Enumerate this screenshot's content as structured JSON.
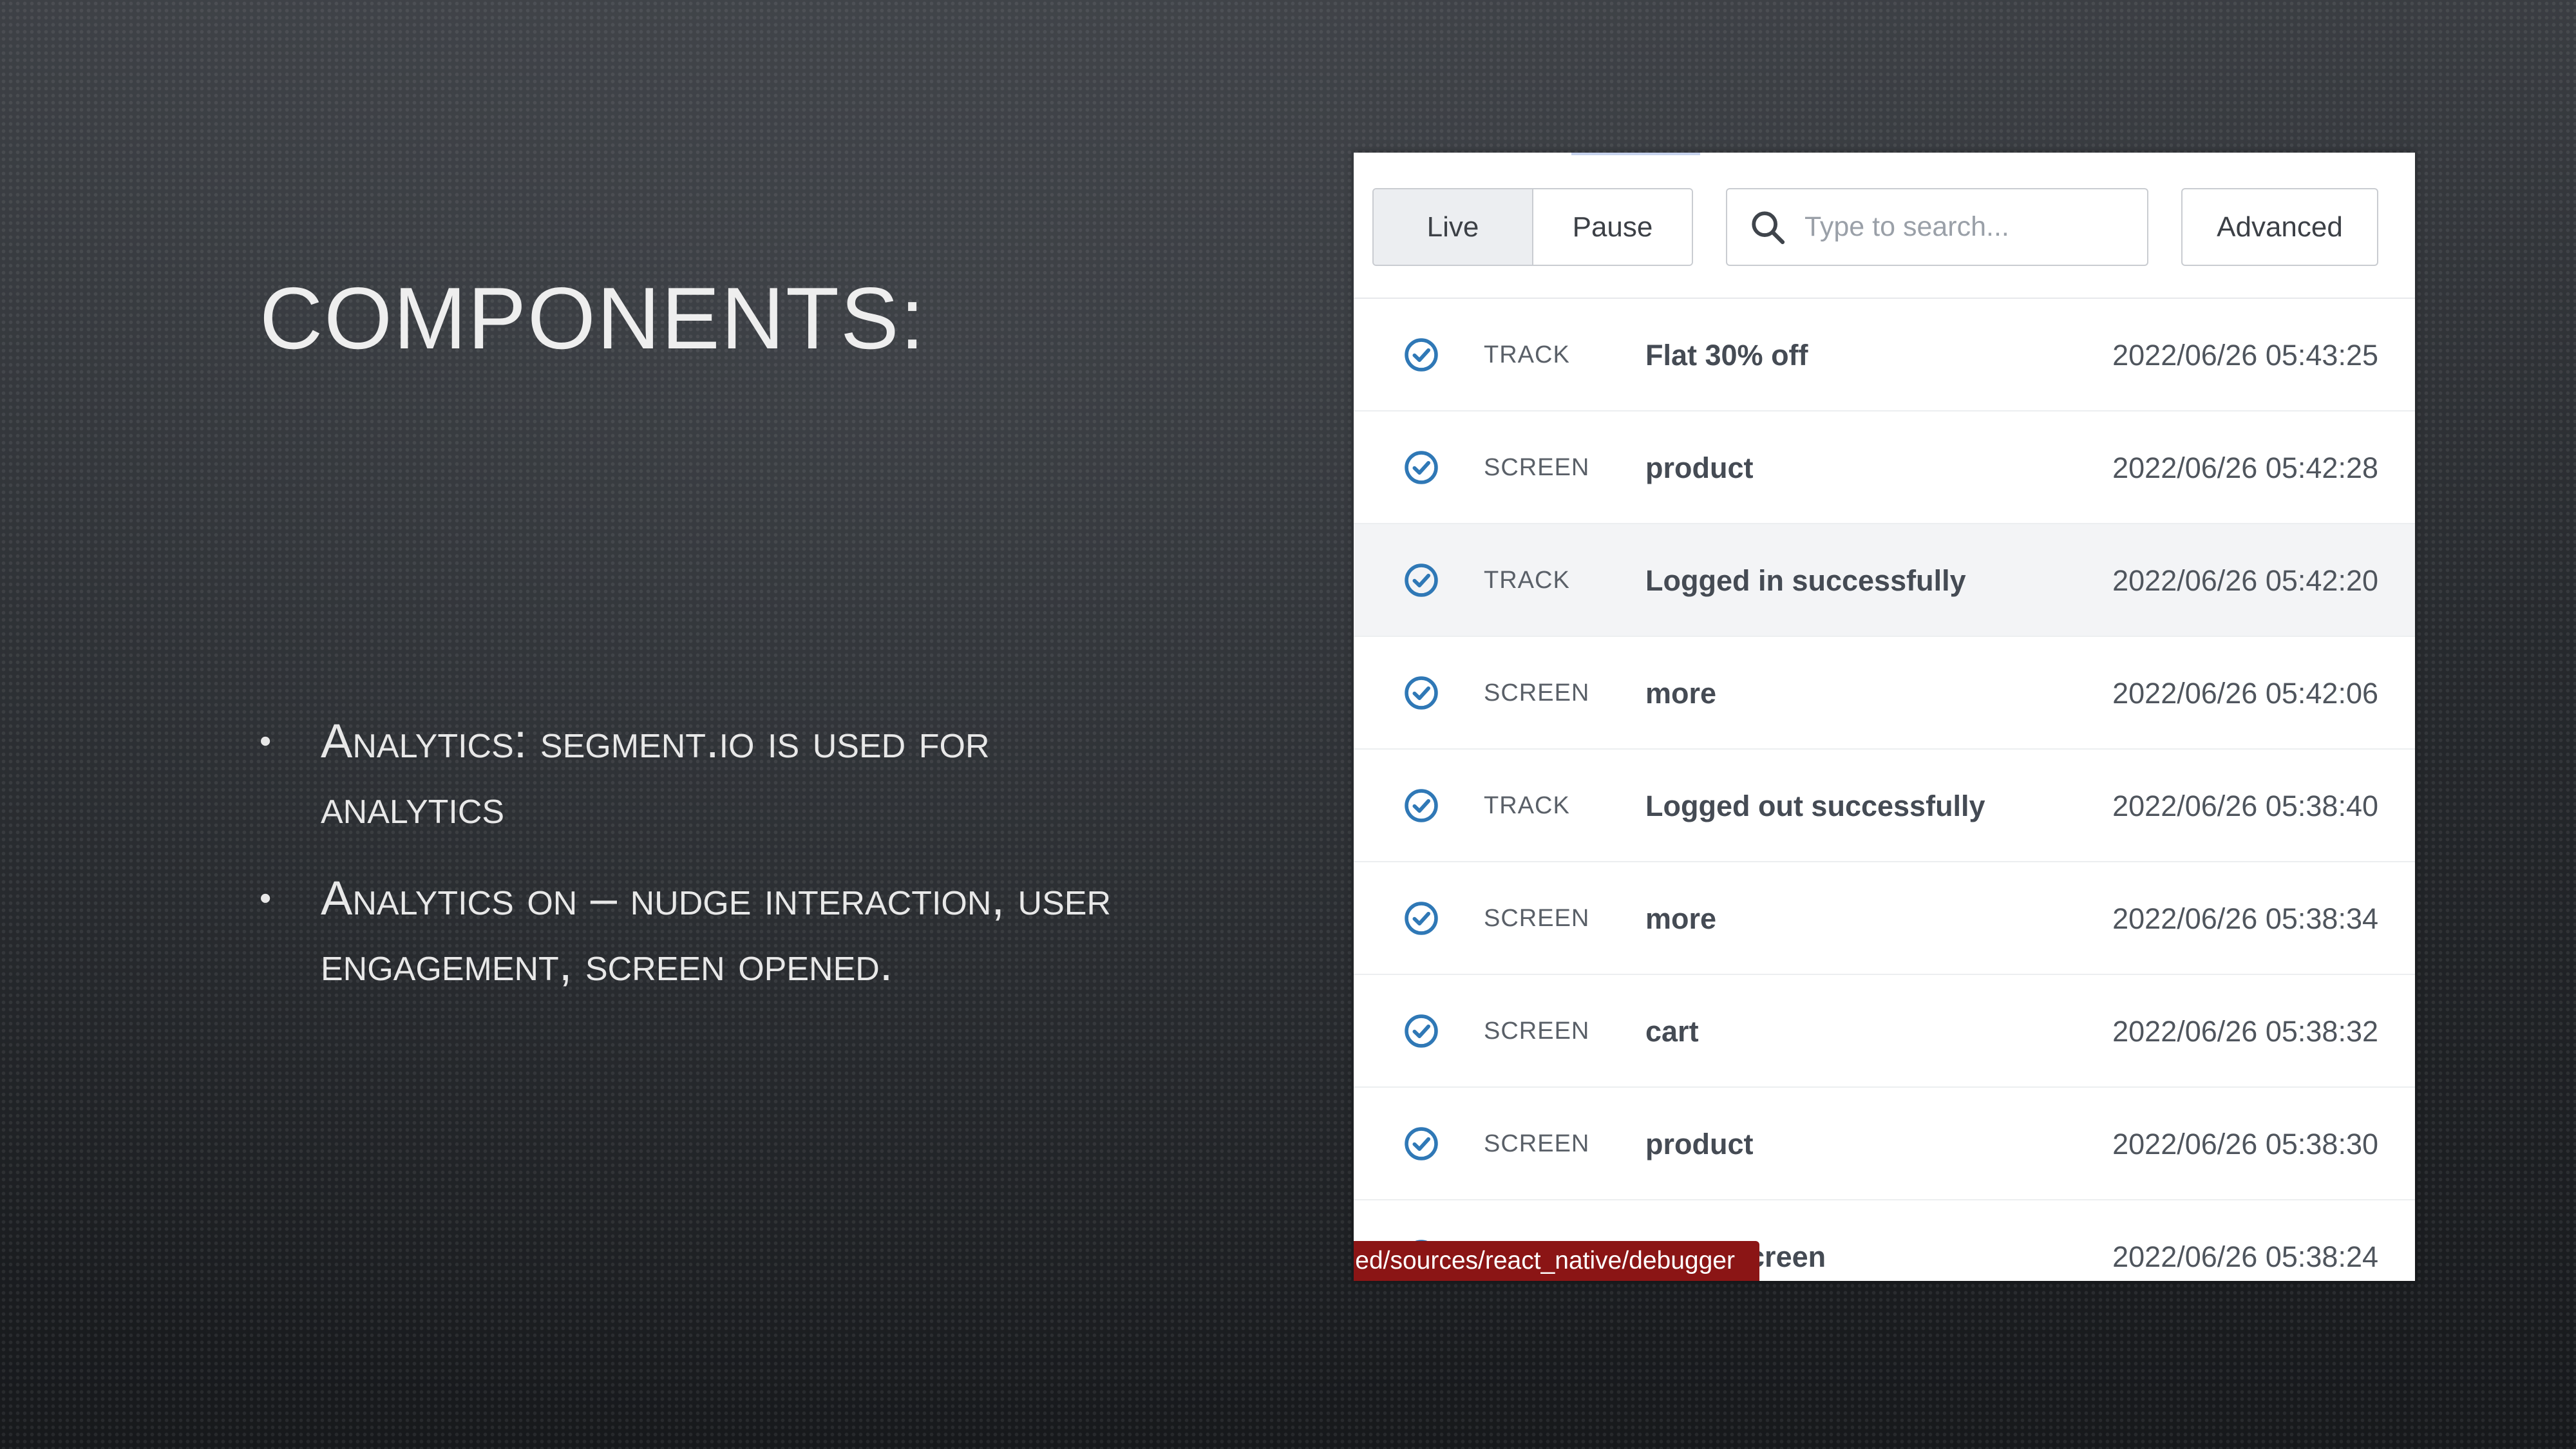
{
  "slide": {
    "title": "Components:",
    "bullets": [
      "Analytics: segment.io is used for analytics",
      "Analytics on – nudge interaction, user engagement, screen opened."
    ]
  },
  "debugger": {
    "mode_tabs": [
      {
        "label": "Live",
        "active": true
      },
      {
        "label": "Pause",
        "active": false
      }
    ],
    "search": {
      "placeholder": "Type to search...",
      "value": "",
      "icon": "search-icon"
    },
    "advanced_label": "Advanced",
    "status_icon": "check-circle-icon",
    "events": [
      {
        "type": "TRACK",
        "name": "Flat 30% off",
        "time": "2022/06/26 05:43:25"
      },
      {
        "type": "SCREEN",
        "name": "product",
        "time": "2022/06/26 05:42:28"
      },
      {
        "type": "TRACK",
        "name": "Logged in successfully",
        "time": "2022/06/26 05:42:20"
      },
      {
        "type": "SCREEN",
        "name": "more",
        "time": "2022/06/26 05:42:06"
      },
      {
        "type": "TRACK",
        "name": "Logged out successfully",
        "time": "2022/06/26 05:38:40"
      },
      {
        "type": "SCREEN",
        "name": "more",
        "time": "2022/06/26 05:38:34"
      },
      {
        "type": "SCREEN",
        "name": "cart",
        "time": "2022/06/26 05:38:32"
      },
      {
        "type": "SCREEN",
        "name": "product",
        "time": "2022/06/26 05:38:30"
      },
      {
        "type": "SCREEN",
        "name": "home-screen",
        "time": "2022/06/26 05:38:24"
      }
    ],
    "url_tooltip": "ed/sources/react_native/debugger"
  },
  "colors": {
    "icon_blue": "#2f78b6",
    "tooltip_bg": "#8b1515"
  }
}
